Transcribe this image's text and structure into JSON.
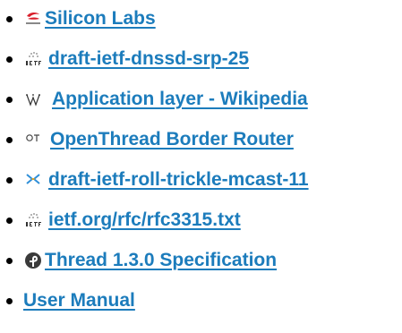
{
  "colors": {
    "link": "#1c7cbc",
    "bullet": "#000000"
  },
  "links": [
    {
      "label": "Silicon Labs",
      "icon": "silicon-labs-icon"
    },
    {
      "label": "draft-ietf-dnssd-srp-25",
      "icon": "ietf-icon"
    },
    {
      "label": "Application layer - Wikipedia",
      "icon": "wikipedia-icon"
    },
    {
      "label": "OpenThread Border Router",
      "icon": "openthread-icon"
    },
    {
      "label": "draft-ietf-roll-trickle-mcast-11",
      "icon": "datatracker-icon"
    },
    {
      "label": "ietf.org/rfc/rfc3315.txt",
      "icon": "ietf-icon"
    },
    {
      "label": "Thread 1.3.0 Specification",
      "icon": "thread-icon"
    },
    {
      "label": "User Manual",
      "icon": ""
    }
  ]
}
